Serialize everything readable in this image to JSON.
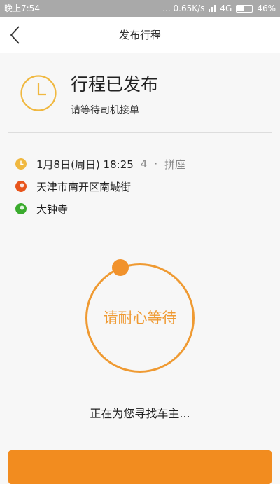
{
  "status_bar": {
    "time": "晚上7:54",
    "network_speed": "... 0.65K/s",
    "network_type": "4G",
    "battery": "46%",
    "battery_level": 0.46
  },
  "header": {
    "title": "发布行程",
    "back_icon": "chevron-left-icon"
  },
  "status": {
    "icon": "clock-icon",
    "title": "行程已发布",
    "subtitle": "请等待司机接单"
  },
  "trip": {
    "time": "1月8日(周日) 18:25",
    "seats": "4",
    "separator": "·",
    "ride_type": "拼座",
    "origin": "天津市南开区南城街",
    "destination": "大钟寺"
  },
  "waiting": {
    "label": "请耐心等待",
    "message": "正在为您寻找车主..."
  },
  "colors": {
    "accent": "#f28c1f",
    "clock": "#f0b840",
    "origin_dot": "#e8551c",
    "destination_dot": "#3bab2e"
  }
}
